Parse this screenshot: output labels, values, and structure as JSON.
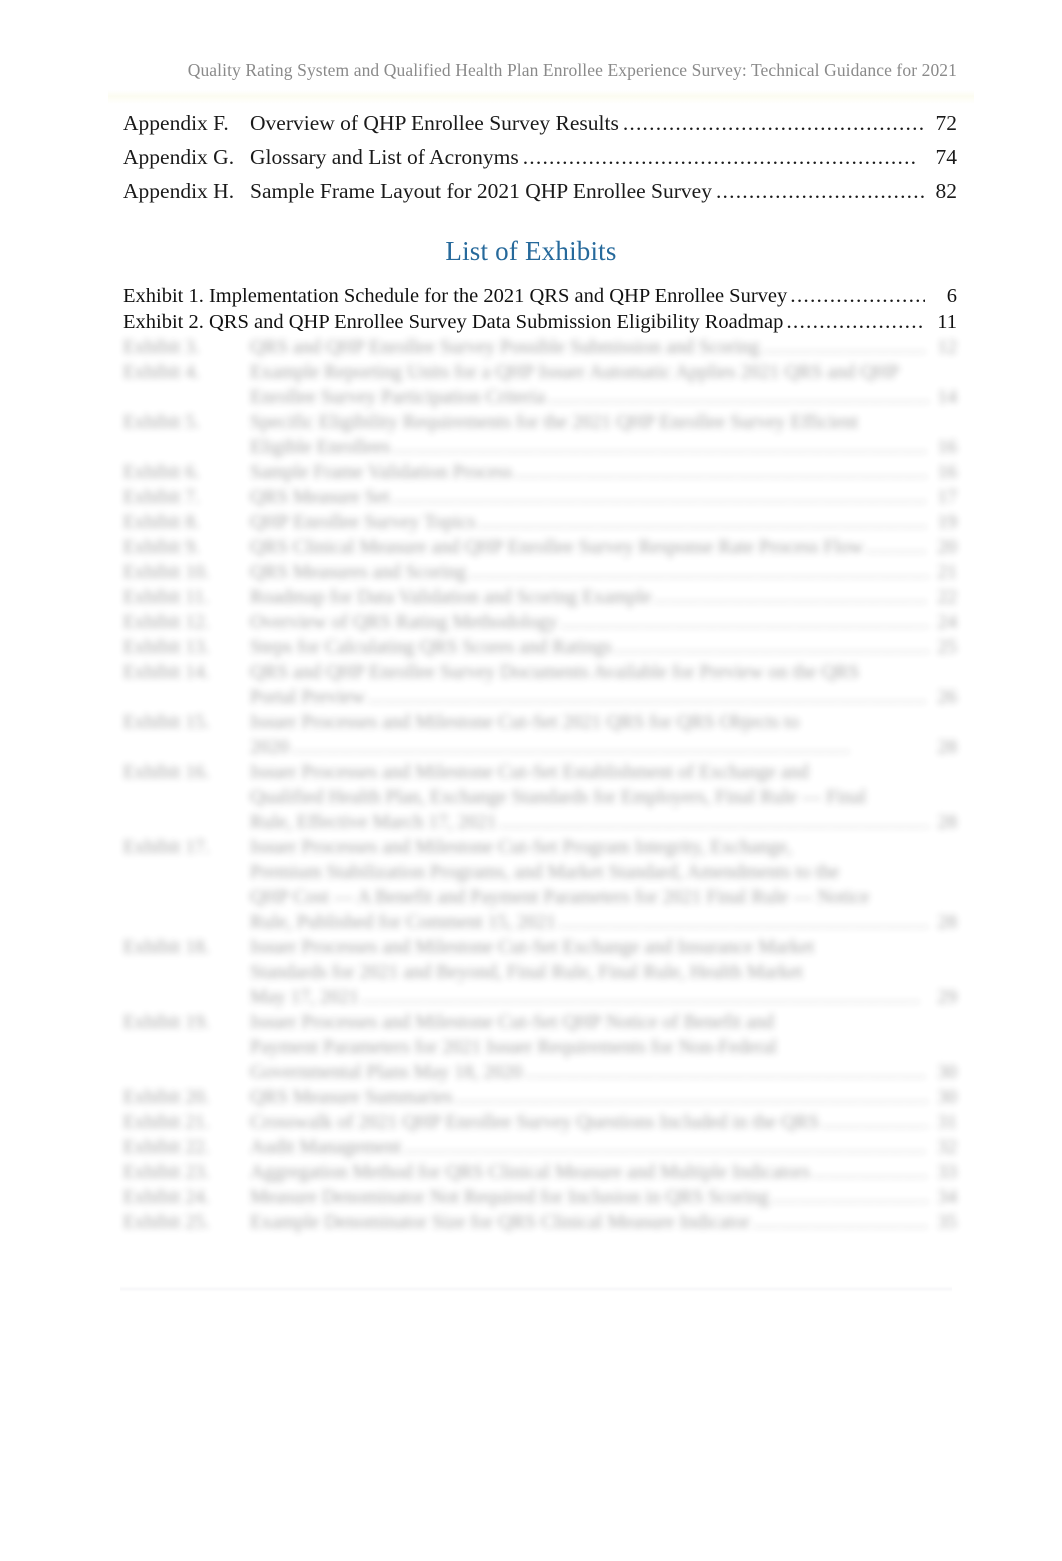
{
  "header": {
    "running_title": "Quality Rating System and Qualified Health Plan Enrollee Experience Survey: Technical Guidance for 2021"
  },
  "appendix_section": {
    "rows": [
      {
        "label": "Appendix F.",
        "title": "Overview of QHP Enrollee Survey Results",
        "leader": "............................................................",
        "page": "72"
      },
      {
        "label": "Appendix G.",
        "title": "Glossary and List of Acronyms",
        "leader": "............................................................",
        "page": "74"
      },
      {
        "label": "Appendix H.",
        "title": "Sample Frame Layout for 2021 QHP Enrollee Survey",
        "leader": "............................................................",
        "page": "82"
      }
    ]
  },
  "exhibits_section": {
    "heading": "List of Exhibits",
    "rows": [
      {
        "text": "Exhibit 1. Implementation Schedule for the 2021 QRS and QHP Enrollee Survey",
        "leader": "....................................................",
        "page": "6"
      },
      {
        "text": "Exhibit 2. QRS and QHP Enrollee Survey Data Submission Eligibility Roadmap",
        "leader": "....................................................",
        "page": "11"
      }
    ],
    "blurred_note": "Remaining exhibit entries are rendered blurred and are illegible in the source image.",
    "blurred_rows": [
      {
        "label": "Exhibit 3.",
        "title": "QRS and QHP Enrollee Survey Possible Submission and Scoring",
        "page": "12",
        "continuation": false
      },
      {
        "label": "Exhibit 4.",
        "title": "Example Reporting Units for a QHP Issuer Automatic Applies 2021 QRS and QHP",
        "page": "",
        "continuation": false
      },
      {
        "label": "",
        "title": "Enrollee Survey Participation Criteria",
        "page": "14",
        "continuation": true
      },
      {
        "label": "Exhibit 5.",
        "title": "Specific Eligibility Requirements for the 2021 QHP Enrollee Survey Efficient",
        "page": "",
        "continuation": false
      },
      {
        "label": "",
        "title": "Eligible Enrollees",
        "page": "16",
        "continuation": true
      },
      {
        "label": "Exhibit 6.",
        "title": "Sample Frame Validation Process",
        "page": "16",
        "continuation": false
      },
      {
        "label": "Exhibit 7.",
        "title": "QRS Measure Set",
        "page": "17",
        "continuation": false
      },
      {
        "label": "Exhibit 8.",
        "title": "QHP Enrollee Survey Topics",
        "page": "19",
        "continuation": false
      },
      {
        "label": "Exhibit 9.",
        "title": "QRS Clinical Measure and QHP Enrollee Survey Response Rate Process Flow",
        "page": "20",
        "continuation": false
      },
      {
        "label": "Exhibit 10.",
        "title": "QRS Measures and Scoring",
        "page": "21",
        "continuation": false
      },
      {
        "label": "Exhibit 11.",
        "title": "Roadmap for Data Validation and Scoring Example",
        "page": "22",
        "continuation": false
      },
      {
        "label": "Exhibit 12.",
        "title": "Overview of QRS Rating Methodology",
        "page": "24",
        "continuation": false
      },
      {
        "label": "Exhibit 13.",
        "title": "Steps for Calculating QRS Scores and Ratings",
        "page": "25",
        "continuation": false
      },
      {
        "label": "Exhibit 14.",
        "title": "QRS and QHP Enrollee Survey Documents Available for Preview on the QRS",
        "page": "",
        "continuation": false
      },
      {
        "label": "",
        "title": "Portal Preview",
        "page": "26",
        "continuation": true
      },
      {
        "label": "Exhibit 15.",
        "title": "Issuer Processes and Milestone Cut-Set 2021 QRS for QRS Objects to",
        "page": "",
        "continuation": false
      },
      {
        "label": "",
        "title": "2020",
        "page": "28",
        "continuation": true
      },
      {
        "label": "Exhibit 16.",
        "title": "Issuer Processes and Milestone Cut-Set Establishment of Exchange and",
        "page": "",
        "continuation": false
      },
      {
        "label": "",
        "title": "Qualified Health Plan, Exchange Standards for Employers, Final Rule — Final",
        "page": "",
        "continuation": true
      },
      {
        "label": "",
        "title": "Rule, Effective March 17, 2021",
        "page": "28",
        "continuation": true
      },
      {
        "label": "Exhibit 17.",
        "title": "Issuer Processes and Milestone Cut-Set Program Integrity, Exchange,",
        "page": "",
        "continuation": false
      },
      {
        "label": "",
        "title": "Premium Stabilization Programs, and Market Standard, Amendments to the",
        "page": "",
        "continuation": true
      },
      {
        "label": "",
        "title": "QHP Cost — A Benefit and Payment Parameters for 2021 Final Rule — Notice",
        "page": "",
        "continuation": true
      },
      {
        "label": "",
        "title": "Rule, Published for Comment 15, 2021",
        "page": "28",
        "continuation": true
      },
      {
        "label": "Exhibit 18.",
        "title": "Issuer Processes and Milestone Cut-Set Exchange and Insurance Market",
        "page": "",
        "continuation": false
      },
      {
        "label": "",
        "title": "Standards for 2021 and Beyond, Final Rule, Final Rule, Health Market",
        "page": "",
        "continuation": true
      },
      {
        "label": "",
        "title": "May 17, 2021",
        "page": "29",
        "continuation": true
      },
      {
        "label": "Exhibit 19.",
        "title": "Issuer Processes and Milestone Cut-Set QHP Notice of Benefit and",
        "page": "",
        "continuation": false
      },
      {
        "label": "",
        "title": "Payment Parameters for 2021 Issuer Requirements for Non-Federal",
        "page": "",
        "continuation": true
      },
      {
        "label": "",
        "title": "Governmental Plans May 18, 2020",
        "page": "30",
        "continuation": true
      },
      {
        "label": "Exhibit 20.",
        "title": "QRS Measure Summaries",
        "page": "30",
        "continuation": false
      },
      {
        "label": "Exhibit 21.",
        "title": "Crosswalk of 2021 QHP Enrollee Survey Questions Included in the QRS",
        "page": "31",
        "continuation": false
      },
      {
        "label": "Exhibit 22.",
        "title": "Audit Management",
        "page": "32",
        "continuation": false
      },
      {
        "label": "Exhibit 23.",
        "title": "Aggregation Method for QRS Clinical Measure and Multiple Indicators",
        "page": "33",
        "continuation": false
      },
      {
        "label": "Exhibit 24.",
        "title": "Measure Denominator Not Required for Inclusion in QRS Scoring",
        "page": "34",
        "continuation": false
      },
      {
        "label": "Exhibit 25.",
        "title": "Example Denominator Size for QRS Clinical Measure Indicator",
        "page": "35",
        "continuation": false
      }
    ]
  }
}
